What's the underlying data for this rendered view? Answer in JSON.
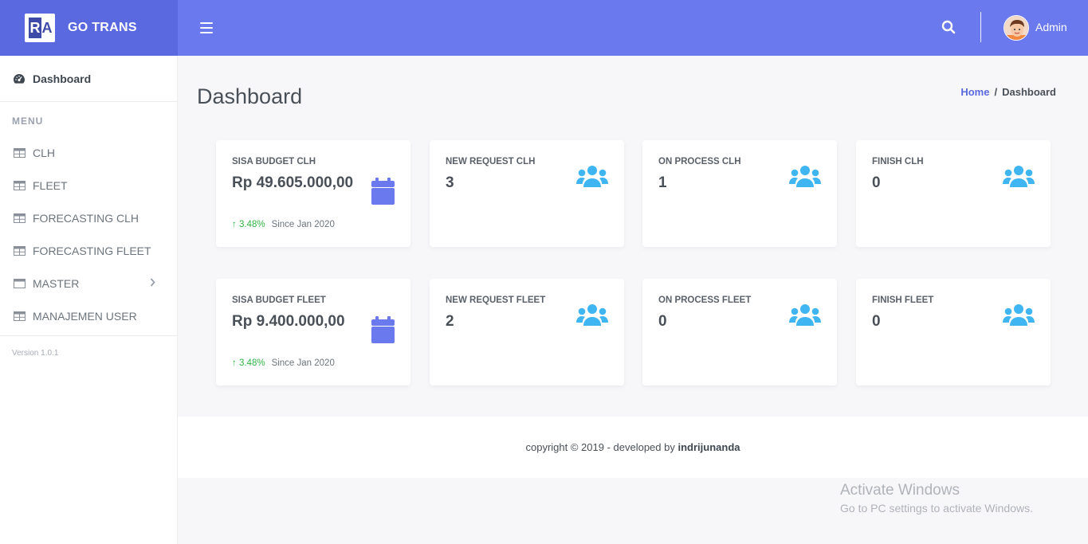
{
  "brand": {
    "logo_text_1": "R",
    "logo_text_2": "A",
    "name": "GO TRANS"
  },
  "header": {
    "user_name": "Admin"
  },
  "sidebar": {
    "dashboard_label": "Dashboard",
    "menu_title": "MENU",
    "items": [
      {
        "label": "CLH",
        "icon": "table-icon"
      },
      {
        "label": "FLEET",
        "icon": "table-icon"
      },
      {
        "label": "FORECASTING CLH",
        "icon": "table-icon"
      },
      {
        "label": "FORECASTING FLEET",
        "icon": "table-icon"
      },
      {
        "label": "MASTER",
        "icon": "window-icon",
        "has_submenu": true
      },
      {
        "label": "MANAJEMEN USER",
        "icon": "table-icon"
      }
    ],
    "version": "Version 1.0.1"
  },
  "page": {
    "title": "Dashboard",
    "breadcrumb": {
      "home": "Home",
      "separator": "/",
      "current": "Dashboard"
    }
  },
  "cards": [
    {
      "label": "SISA BUDGET CLH",
      "value": "Rp 49.605.000,00",
      "trend": "3.48%",
      "since": "Since Jan 2020",
      "icon": "calendar-icon"
    },
    {
      "label": "NEW REQUEST CLH",
      "value": "3",
      "icon": "users-icon"
    },
    {
      "label": "ON PROCESS CLH",
      "value": "1",
      "icon": "users-icon"
    },
    {
      "label": "FINISH CLH",
      "value": "0",
      "icon": "users-icon"
    },
    {
      "label": "SISA BUDGET FLEET",
      "value": "Rp 9.400.000,00",
      "trend": "3.48%",
      "since": "Since Jan 2020",
      "icon": "calendar-icon"
    },
    {
      "label": "NEW REQUEST FLEET",
      "value": "2",
      "icon": "users-icon"
    },
    {
      "label": "ON PROCESS FLEET",
      "value": "0",
      "icon": "users-icon"
    },
    {
      "label": "FINISH FLEET",
      "value": "0",
      "icon": "users-icon"
    }
  ],
  "footer": {
    "text": "copyright © 2019 - developed by",
    "author": "indrijunanda"
  },
  "watermark": {
    "line1": "Activate Windows",
    "line2": "Go to PC settings to activate Windows."
  },
  "colors": {
    "primary": "#6a79ee",
    "accent_icon": "#3fb5f2",
    "calendar_icon": "#6a79ee",
    "trend_up": "#2fb344"
  }
}
